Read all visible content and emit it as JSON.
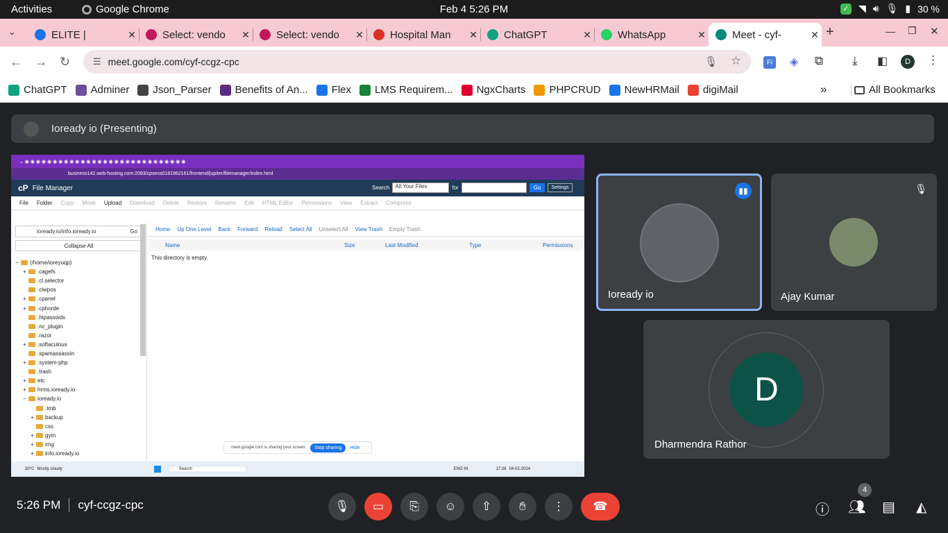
{
  "system": {
    "activities": "Activities",
    "app": "Google Chrome",
    "datetime": "Feb 4   5:26 PM",
    "battery": "30 %"
  },
  "tabs": [
    {
      "label": "ELITE |",
      "color": "#1a73e8"
    },
    {
      "label": "Select: vendo",
      "color": "#c2185b"
    },
    {
      "label": "Select: vendo",
      "color": "#c2185b"
    },
    {
      "label": "Hospital Man",
      "color": "#d93025"
    },
    {
      "label": "ChatGPT",
      "color": "#10a37f"
    },
    {
      "label": "WhatsApp",
      "color": "#25d366"
    },
    {
      "label": "Meet - cyf-",
      "color": "#00897b"
    }
  ],
  "address": {
    "url": "meet.google.com/cyf-ccgz-cpc",
    "profile": "D"
  },
  "bookmarks": [
    {
      "label": "ChatGPT",
      "color": "#10a37f"
    },
    {
      "label": "Adminer",
      "color": "#6a4f9c"
    },
    {
      "label": "Json_Parser",
      "color": "#444444"
    },
    {
      "label": "Benefits of An...",
      "color": "#5b2c83"
    },
    {
      "label": "Flex",
      "color": "#1a73e8"
    },
    {
      "label": "LMS Requirem...",
      "color": "#188038"
    },
    {
      "label": "NgxCharts",
      "color": "#dd0031"
    },
    {
      "label": "PHPCRUD",
      "color": "#f29900"
    },
    {
      "label": "NewHRMail",
      "color": "#1a73e8"
    },
    {
      "label": "digiMail",
      "color": "#ea4335"
    }
  ],
  "all_bookmarks": "All Bookmarks",
  "presenting": "Ioready io (Presenting)",
  "shared": {
    "url": "business142.web-hosting.com:2083/cpsess0181962161/frontend/jupiter/filemanager/index.html",
    "title": "File Manager",
    "search_label": "Search",
    "search_scope": "All Your Files",
    "for_label": "for",
    "go": "Go",
    "settings": "Settings",
    "toolbar": [
      "File",
      "Folder",
      "Copy",
      "Move",
      "Upload",
      "Download",
      "Delete",
      "Restore",
      "Rename",
      "Edit",
      "HTML Editor",
      "Permissions",
      "View",
      "Extract",
      "Compress"
    ],
    "path": "ioready.io/info.ioready.io",
    "path_go": "Go",
    "collapse": "Collapse All",
    "tree": [
      {
        "label": "(/home/ioreyuqp)",
        "d": 0,
        "p": "−"
      },
      {
        "label": ".cagefs",
        "d": 1,
        "p": "+"
      },
      {
        "label": ".cl.selector",
        "d": 1,
        "p": ""
      },
      {
        "label": ".clwpos",
        "d": 1,
        "p": ""
      },
      {
        "label": ".cpanel",
        "d": 1,
        "p": "+"
      },
      {
        "label": ".cphorde",
        "d": 1,
        "p": "+"
      },
      {
        "label": ".htpasswds",
        "d": 1,
        "p": ""
      },
      {
        "label": ".nc_plugin",
        "d": 1,
        "p": ""
      },
      {
        "label": ".razor",
        "d": 1,
        "p": ""
      },
      {
        "label": ".softaculous",
        "d": 1,
        "p": "+"
      },
      {
        "label": ".spamassassin",
        "d": 1,
        "p": ""
      },
      {
        "label": ".system-php",
        "d": 1,
        "p": "+"
      },
      {
        "label": ".trash",
        "d": 1,
        "p": ""
      },
      {
        "label": "etc",
        "d": 1,
        "p": "+"
      },
      {
        "label": "hrms.ioready.io",
        "d": 1,
        "p": "+"
      },
      {
        "label": "ioready.io",
        "d": 1,
        "p": "−"
      },
      {
        "label": ".tmb",
        "d": 2,
        "p": ""
      },
      {
        "label": "backup",
        "d": 2,
        "p": "+"
      },
      {
        "label": "css",
        "d": 2,
        "p": ""
      },
      {
        "label": "gym",
        "d": 2,
        "p": "+"
      },
      {
        "label": "img",
        "d": 2,
        "p": "+"
      },
      {
        "label": "info.ioready.io",
        "d": 2,
        "p": "+"
      }
    ],
    "subnav": [
      "Home",
      "Up One Level",
      "Back",
      "Forward",
      "Reload",
      "Select All",
      "Unselect All",
      "View Trash",
      "Empty Trash"
    ],
    "columns": [
      "Name",
      "Size",
      "Last Modified",
      "Type",
      "Permissions"
    ],
    "empty": "This directory is empty.",
    "notice": "meet.google.com is sharing your screen.",
    "stop": "Stop sharing",
    "hide": "Hide",
    "weather_temp": "30°C",
    "weather_text": "Mostly cloudy",
    "task_search": "Search",
    "task_lang": "ENG IN",
    "task_time": "17:26",
    "task_date": "04-02-2024"
  },
  "participants": [
    {
      "name": "Ioready io",
      "speaking": true
    },
    {
      "name": "Ajay Kumar",
      "muted": true
    },
    {
      "name": "Dharmendra Rathor",
      "initial": "D"
    }
  ],
  "meeting": {
    "time": "5:26 PM",
    "code": "cyf-ccgz-cpc",
    "people_count": "4"
  }
}
